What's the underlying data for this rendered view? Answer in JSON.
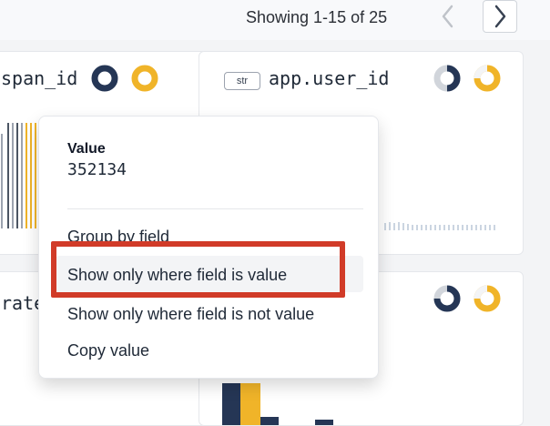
{
  "topbar": {
    "pagination_text": "Showing 1-15 of 25"
  },
  "cards": {
    "top_left": {
      "label": "span_id"
    },
    "top_right": {
      "badge": "str",
      "label": "app.user_id"
    },
    "bottom_left": {
      "label": "rate"
    }
  },
  "menu": {
    "value_label": "Value",
    "value_text": "352134",
    "items": [
      "Group by field",
      "Show only where field is value",
      "Show only where field is not value",
      "Copy value"
    ]
  },
  "colors": {
    "navy": "#253655",
    "amber": "#f0b429",
    "highlight": "#d13b28",
    "gray_bar": "#9ca3af"
  }
}
